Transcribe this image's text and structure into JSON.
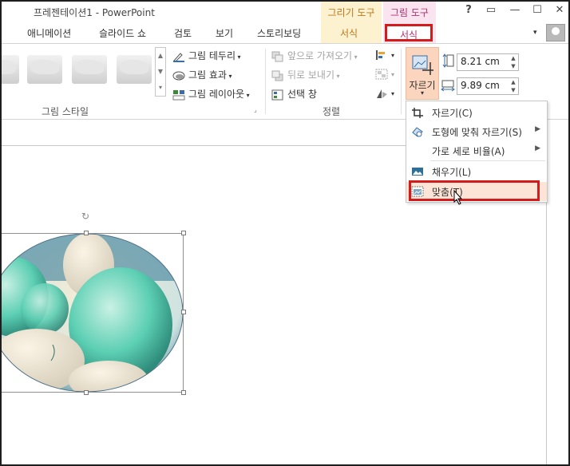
{
  "window": {
    "title": "프레젠테이션1 - PowerPoint",
    "context_draw": "그리기 도구",
    "context_picture": "그림 도구",
    "help": "?",
    "restore": "▭",
    "minimize": "—",
    "maximize": "☐",
    "close": "✕"
  },
  "tabs": {
    "animation": "애니메이션",
    "slideshow": "슬라이드 쇼",
    "review": "검토",
    "view": "보기",
    "storyboard": "스토리보딩",
    "draw_format": "서식",
    "pic_format": "서식",
    "collapse": "▾"
  },
  "ribbon": {
    "picture_border": "그림 테두리",
    "picture_effects": "그림 효과",
    "picture_layout": "그림 레이아웃",
    "bring_forward": "앞으로 가져오기",
    "send_backward": "뒤로 보내기",
    "selection_pane": "선택 창",
    "crop": "자르기",
    "height": "8.21 cm",
    "width": "9.89 cm",
    "group_styles": "그림 스타일",
    "group_arrange": "정렬"
  },
  "crop_menu": {
    "items": [
      {
        "label": "자르기(C)",
        "icon": "crop-icon",
        "submenu": false
      },
      {
        "label": "도형에 맞춰 자르기(S)",
        "icon": "crop-shape-icon",
        "submenu": true
      },
      {
        "label": "가로 세로 비율(A)",
        "icon": "",
        "submenu": true
      },
      {
        "label": "채우기(L)",
        "icon": "fill-icon",
        "submenu": false
      },
      {
        "label": "맞춤(T)",
        "icon": "fit-icon",
        "submenu": false
      }
    ],
    "hovered_index": 4
  },
  "colors": {
    "accent_red": "#d31b1b",
    "context_draw": "#c0761b",
    "context_picture": "#b03070",
    "crop_active": "#fbd5bd"
  }
}
